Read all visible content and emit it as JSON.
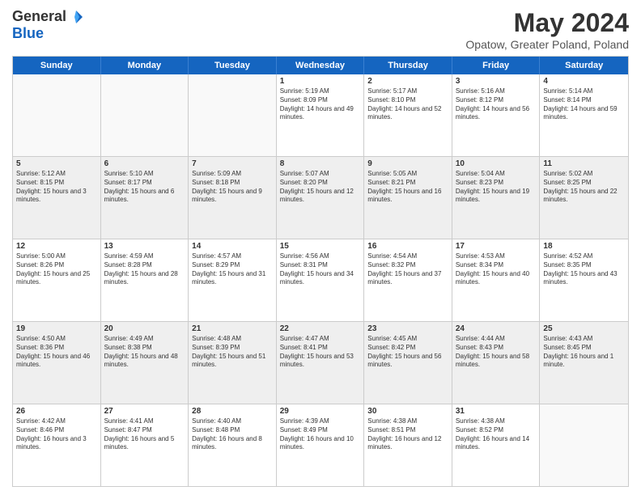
{
  "header": {
    "logo": {
      "general": "General",
      "blue": "Blue"
    },
    "title": "May 2024",
    "subtitle": "Opatow, Greater Poland, Poland"
  },
  "weekdays": [
    "Sunday",
    "Monday",
    "Tuesday",
    "Wednesday",
    "Thursday",
    "Friday",
    "Saturday"
  ],
  "weeks": [
    [
      {
        "day": "",
        "empty": true
      },
      {
        "day": "",
        "empty": true
      },
      {
        "day": "",
        "empty": true
      },
      {
        "day": "1",
        "sunrise": "5:19 AM",
        "sunset": "8:09 PM",
        "daylight": "14 hours and 49 minutes."
      },
      {
        "day": "2",
        "sunrise": "5:17 AM",
        "sunset": "8:10 PM",
        "daylight": "14 hours and 52 minutes."
      },
      {
        "day": "3",
        "sunrise": "5:16 AM",
        "sunset": "8:12 PM",
        "daylight": "14 hours and 56 minutes."
      },
      {
        "day": "4",
        "sunrise": "5:14 AM",
        "sunset": "8:14 PM",
        "daylight": "14 hours and 59 minutes."
      }
    ],
    [
      {
        "day": "5",
        "sunrise": "5:12 AM",
        "sunset": "8:15 PM",
        "daylight": "15 hours and 3 minutes."
      },
      {
        "day": "6",
        "sunrise": "5:10 AM",
        "sunset": "8:17 PM",
        "daylight": "15 hours and 6 minutes."
      },
      {
        "day": "7",
        "sunrise": "5:09 AM",
        "sunset": "8:18 PM",
        "daylight": "15 hours and 9 minutes."
      },
      {
        "day": "8",
        "sunrise": "5:07 AM",
        "sunset": "8:20 PM",
        "daylight": "15 hours and 12 minutes."
      },
      {
        "day": "9",
        "sunrise": "5:05 AM",
        "sunset": "8:21 PM",
        "daylight": "15 hours and 16 minutes."
      },
      {
        "day": "10",
        "sunrise": "5:04 AM",
        "sunset": "8:23 PM",
        "daylight": "15 hours and 19 minutes."
      },
      {
        "day": "11",
        "sunrise": "5:02 AM",
        "sunset": "8:25 PM",
        "daylight": "15 hours and 22 minutes."
      }
    ],
    [
      {
        "day": "12",
        "sunrise": "5:00 AM",
        "sunset": "8:26 PM",
        "daylight": "15 hours and 25 minutes."
      },
      {
        "day": "13",
        "sunrise": "4:59 AM",
        "sunset": "8:28 PM",
        "daylight": "15 hours and 28 minutes."
      },
      {
        "day": "14",
        "sunrise": "4:57 AM",
        "sunset": "8:29 PM",
        "daylight": "15 hours and 31 minutes."
      },
      {
        "day": "15",
        "sunrise": "4:56 AM",
        "sunset": "8:31 PM",
        "daylight": "15 hours and 34 minutes."
      },
      {
        "day": "16",
        "sunrise": "4:54 AM",
        "sunset": "8:32 PM",
        "daylight": "15 hours and 37 minutes."
      },
      {
        "day": "17",
        "sunrise": "4:53 AM",
        "sunset": "8:34 PM",
        "daylight": "15 hours and 40 minutes."
      },
      {
        "day": "18",
        "sunrise": "4:52 AM",
        "sunset": "8:35 PM",
        "daylight": "15 hours and 43 minutes."
      }
    ],
    [
      {
        "day": "19",
        "sunrise": "4:50 AM",
        "sunset": "8:36 PM",
        "daylight": "15 hours and 46 minutes."
      },
      {
        "day": "20",
        "sunrise": "4:49 AM",
        "sunset": "8:38 PM",
        "daylight": "15 hours and 48 minutes."
      },
      {
        "day": "21",
        "sunrise": "4:48 AM",
        "sunset": "8:39 PM",
        "daylight": "15 hours and 51 minutes."
      },
      {
        "day": "22",
        "sunrise": "4:47 AM",
        "sunset": "8:41 PM",
        "daylight": "15 hours and 53 minutes."
      },
      {
        "day": "23",
        "sunrise": "4:45 AM",
        "sunset": "8:42 PM",
        "daylight": "15 hours and 56 minutes."
      },
      {
        "day": "24",
        "sunrise": "4:44 AM",
        "sunset": "8:43 PM",
        "daylight": "15 hours and 58 minutes."
      },
      {
        "day": "25",
        "sunrise": "4:43 AM",
        "sunset": "8:45 PM",
        "daylight": "16 hours and 1 minute."
      }
    ],
    [
      {
        "day": "26",
        "sunrise": "4:42 AM",
        "sunset": "8:46 PM",
        "daylight": "16 hours and 3 minutes."
      },
      {
        "day": "27",
        "sunrise": "4:41 AM",
        "sunset": "8:47 PM",
        "daylight": "16 hours and 5 minutes."
      },
      {
        "day": "28",
        "sunrise": "4:40 AM",
        "sunset": "8:48 PM",
        "daylight": "16 hours and 8 minutes."
      },
      {
        "day": "29",
        "sunrise": "4:39 AM",
        "sunset": "8:49 PM",
        "daylight": "16 hours and 10 minutes."
      },
      {
        "day": "30",
        "sunrise": "4:38 AM",
        "sunset": "8:51 PM",
        "daylight": "16 hours and 12 minutes."
      },
      {
        "day": "31",
        "sunrise": "4:38 AM",
        "sunset": "8:52 PM",
        "daylight": "16 hours and 14 minutes."
      },
      {
        "day": "",
        "empty": true
      }
    ]
  ]
}
